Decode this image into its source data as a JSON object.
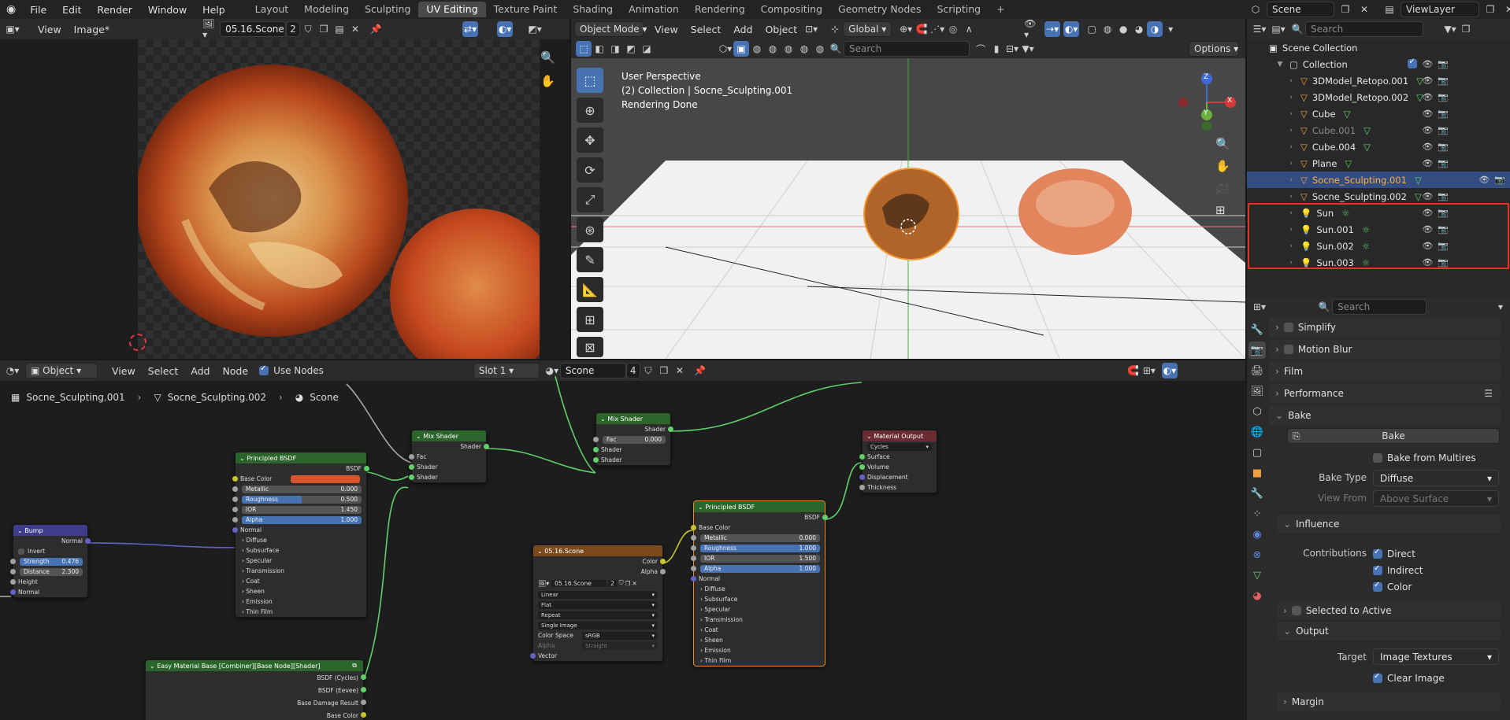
{
  "topbar": {
    "menus": [
      "File",
      "Edit",
      "Render",
      "Window",
      "Help"
    ],
    "workspaces": [
      "Layout",
      "Modeling",
      "Sculpting",
      "UV Editing",
      "Texture Paint",
      "Shading",
      "Animation",
      "Rendering",
      "Compositing",
      "Geometry Nodes",
      "Scripting"
    ],
    "active_workspace": "UV Editing",
    "add_label": "+",
    "scene": "Scene",
    "view_layer": "ViewLayer"
  },
  "uv_editor": {
    "menus": [
      "View",
      "Image*"
    ],
    "image_name": "05.16.Scone",
    "users": "2"
  },
  "viewport": {
    "mode": "Object Mode",
    "menus": [
      "View",
      "Select",
      "Add",
      "Object"
    ],
    "orientation": "Global",
    "search_placeholder": "Search",
    "options_label": "Options",
    "overlay_line1": "User Perspective",
    "overlay_line2": "(2) Collection | Socne_Sculpting.001",
    "overlay_line3": "Rendering Done",
    "gizmo": {
      "z": "Z",
      "y": "Y",
      "x": "X"
    }
  },
  "outliner": {
    "search_placeholder": "Search",
    "scene_collection": "Scene Collection",
    "collection": "Collection",
    "items": [
      {
        "name": "3DModel_Retopo.001",
        "type": "mesh",
        "dim": false,
        "selected": false
      },
      {
        "name": "3DModel_Retopo.002",
        "type": "mesh",
        "dim": false,
        "selected": false
      },
      {
        "name": "Cube",
        "type": "mesh",
        "dim": false,
        "selected": false
      },
      {
        "name": "Cube.001",
        "type": "mesh",
        "dim": true,
        "selected": false
      },
      {
        "name": "Cube.004",
        "type": "mesh",
        "dim": false,
        "selected": false
      },
      {
        "name": "Plane",
        "type": "mesh",
        "dim": false,
        "selected": false
      },
      {
        "name": "Socne_Sculpting.001",
        "type": "mesh",
        "dim": false,
        "selected": true
      },
      {
        "name": "Socne_Sculpting.002",
        "type": "mesh",
        "dim": false,
        "selected": false
      },
      {
        "name": "Sun",
        "type": "light",
        "dim": false,
        "selected": false
      },
      {
        "name": "Sun.001",
        "type": "light",
        "dim": false,
        "selected": false
      },
      {
        "name": "Sun.002",
        "type": "light",
        "dim": false,
        "selected": false
      },
      {
        "name": "Sun.003",
        "type": "light",
        "dim": false,
        "selected": false
      }
    ],
    "highlight_color": "#e8321f"
  },
  "node_editor": {
    "object_label": "Object",
    "menus": [
      "View",
      "Select",
      "Add",
      "Node"
    ],
    "use_nodes": "Use Nodes",
    "slot": "Slot 1",
    "material": "Scone",
    "material_users": "4",
    "breadcrumb": [
      "Socne_Sculpting.001",
      "Socne_Sculpting.002",
      "Scone"
    ]
  },
  "nodes": {
    "bump": {
      "title": "Bump",
      "normal_out": "Normal",
      "invert": "Invert",
      "strength_label": "Strength",
      "strength": "0.476",
      "distance_label": "Distance",
      "distance": "2.300",
      "height": "Height",
      "normal_in": "Normal"
    },
    "pbsdf1": {
      "title": "Principled BSDF",
      "bsdf": "BSDF",
      "base_color": "Base Color",
      "metallic_l": "Metallic",
      "metallic": "0.000",
      "roughness_l": "Roughness",
      "roughness": "0.500",
      "ior_l": "IOR",
      "ior": "1.450",
      "alpha_l": "Alpha",
      "alpha": "1.000",
      "normal": "Normal",
      "subs": [
        "Diffuse",
        "Subsurface",
        "Specular",
        "Transmission",
        "Coat",
        "Sheen",
        "Emission",
        "Thin Film"
      ]
    },
    "mix1": {
      "title": "Mix Shader",
      "shader_out": "Shader",
      "fac": "Fac",
      "shader_a": "Shader",
      "shader_b": "Shader"
    },
    "mix2": {
      "title": "Mix Shader",
      "shader_out": "Shader",
      "fac_l": "Fac",
      "fac": "0.000",
      "shader_a": "Shader",
      "shader_b": "Shader"
    },
    "matout": {
      "title": "Material Output",
      "target": "Cycles",
      "surface": "Surface",
      "volume": "Volume",
      "displacement": "Displacement",
      "thickness": "Thickness"
    },
    "pbsdf2": {
      "title": "Principled BSDF",
      "bsdf": "BSDF",
      "base_color": "Base Color",
      "metallic_l": "Metallic",
      "metallic": "0.000",
      "roughness_l": "Roughness",
      "roughness": "1.000",
      "ior_l": "IOR",
      "ior": "1.500",
      "alpha_l": "Alpha",
      "alpha": "1.000",
      "normal": "Normal",
      "subs": [
        "Diffuse",
        "Subsurface",
        "Specular",
        "Transmission",
        "Coat",
        "Sheen",
        "Emission",
        "Thin Film"
      ]
    },
    "image": {
      "title": "05.16.Scone",
      "color": "Color",
      "alpha": "Alpha",
      "img": "05.16.Scone",
      "users": "2",
      "interp": "Linear",
      "proj": "Flat",
      "ext": "Repeat",
      "source": "Single Image",
      "cs_label": "Color Space",
      "cs": "sRGB",
      "alpha_l": "Alpha",
      "alpha_mode": "Straight",
      "vector": "Vector"
    },
    "easy": {
      "title": "Easy Material Base [Combiner][Base Node][Shader]",
      "out1": "BSDF (Cycles)",
      "out2": "BSDF (Eevee)",
      "out3": "Base Damage Result",
      "out4": "Base Color"
    }
  },
  "properties": {
    "search_placeholder": "Search",
    "simplify": "Simplify",
    "motion_blur": "Motion Blur",
    "film": "Film",
    "performance": "Performance",
    "bake_section": "Bake",
    "bake_button": "Bake",
    "bake_from_multires": "Bake from Multires",
    "bake_type_label": "Bake Type",
    "bake_type": "Diffuse",
    "view_from_label": "View From",
    "view_from": "Above Surface",
    "influence": "Influence",
    "contributions_label": "Contributions",
    "direct": "Direct",
    "indirect": "Indirect",
    "color": "Color",
    "selected_to_active": "Selected to Active",
    "output": "Output",
    "target_label": "Target",
    "target": "Image Textures",
    "clear_image": "Clear Image",
    "margin": "Margin"
  }
}
